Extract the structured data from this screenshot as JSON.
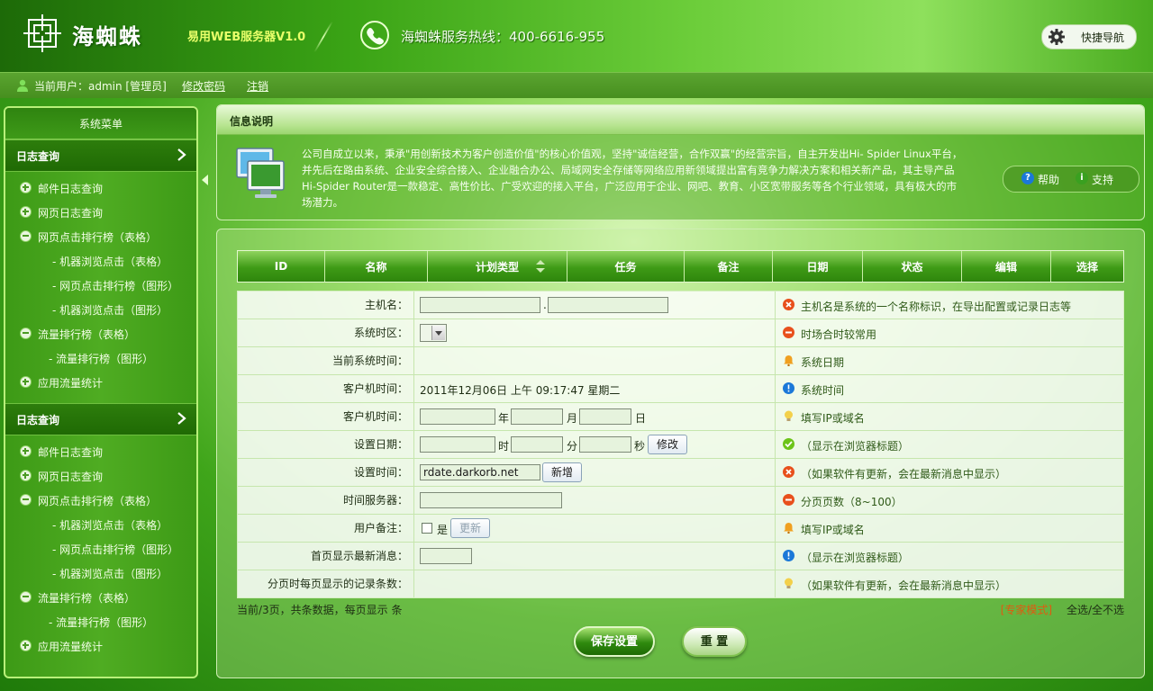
{
  "header": {
    "brand": "海蜘蛛",
    "product": "易用WEB服务器V1.0",
    "hotline": "海蜘蛛服务热线：400-6616-955",
    "quick_nav": "快捷导航"
  },
  "userbar": {
    "current_user": "当前用户：admin [管理员]",
    "change_password": "修改密码",
    "logout": "注销"
  },
  "sidebar": {
    "title": "系统菜单",
    "groups": [
      {
        "heading": "日志查询",
        "items": [
          "邮件日志查询",
          "网页日志查询",
          "网页点击排行榜（表格）",
          "- 机器浏览点击（表格）",
          "- 网页点击排行榜（图形）",
          "- 机器浏览点击（图形）",
          "流量排行榜（表格）",
          "- 流量排行榜（图形）",
          "应用流量统计"
        ]
      },
      {
        "heading": "日志查询",
        "items": [
          "邮件日志查询",
          "网页日志查询",
          "网页点击排行榜（表格）",
          "- 机器浏览点击（表格）",
          "- 网页点击排行榜（图形）",
          "- 机器浏览点击（图形）",
          "流量排行榜（表格）",
          "- 流量排行榜（图形）",
          "应用流量统计"
        ]
      }
    ]
  },
  "info": {
    "title": "信息说明",
    "lines": [
      "公司自成立以来，秉承\"用创新技术为客户创造价值\"的核心价值观，坚持\"诚信经营，合作双赢\"的经营宗旨，自主开发出Hi- Spider Linux平台，",
      "并先后在路由系统、企业安全综合接入、企业融合办公、局域网安全存储等网络应用新领域提出富有竞争力解决方案和相关新产品，其主导产品",
      "Hi-Spider Router是一款稳定、高性价比、广受欢迎的接入平台，广泛应用于企业、网吧、教育、小区宽带服务等各个行业领域，具有极大的市",
      "场潜力。"
    ],
    "help": "帮助",
    "support": "支持"
  },
  "table": {
    "columns": [
      "ID",
      "名称",
      "计划类型",
      "任务",
      "备注",
      "日期",
      "状态",
      "编辑",
      "选择"
    ]
  },
  "form": {
    "host_label": "主机名：",
    "host_dot": ".",
    "host_tip": "主机名是系统的一个名称标识，在导出配置或记录日志等",
    "tz_label": "系统时区：",
    "tz_tip": "时场合时较常用",
    "systime_label": "当前系统时间：",
    "systime_tip": "系统日期",
    "client_label": "客户机时间：",
    "client_value": "2011年12月06日  上午 09:17:47  星期二",
    "client_tip": "系统时间",
    "client2_label": "客户机时间：",
    "year": "年",
    "month": "月",
    "day": "日",
    "client2_tip": "填写IP或域名",
    "setdate_label": "设置日期：",
    "hour": "时",
    "minute": "分",
    "second": "秒",
    "modify_btn": "修改",
    "setdate_tip": "（显示在浏览器标题）",
    "settime_label": "设置时间：",
    "settime_value": "rdate.darkorb.net",
    "add_btn": "新增",
    "settime_tip": "（如果软件有更新，会在最新消息中显示）",
    "timeserver_label": "时间服务器：",
    "timeserver_tip": "分页页数（8~100）",
    "remark_label": "用户备注：",
    "yes": "是",
    "update_btn": "更新",
    "remark_tip": "填写IP或域名",
    "news_label": "首页显示最新消息：",
    "news_tip": "（显示在浏览器标题）",
    "perpage_label": "分页时每页显示的记录条数：",
    "perpage_tip": "（如果软件有更新，会在最新消息中显示）"
  },
  "footer": {
    "pager": "当前/3页，共条数据，每页显示 条",
    "expert": "[专家模式]",
    "select_all": "全选/全不选",
    "save": "保存设置",
    "reset": "重 置"
  },
  "colors": {
    "error": "#e8501c",
    "warn": "#f0a020",
    "info": "#1b78d8",
    "ok": "#6cc418"
  }
}
